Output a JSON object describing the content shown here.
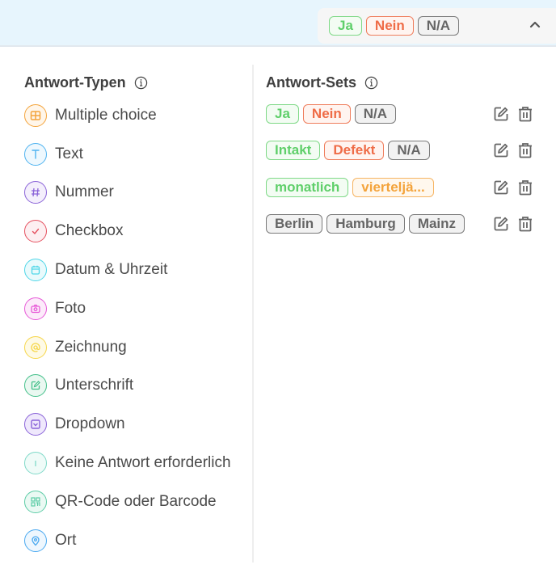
{
  "header": {
    "selected_set": [
      {
        "label": "Ja",
        "color": "green"
      },
      {
        "label": "Nein",
        "color": "red"
      },
      {
        "label": "N/A",
        "color": "gray"
      }
    ],
    "toggle_icon": "chevron-up-icon"
  },
  "answer_types": {
    "title": "Antwort-Typen",
    "info_icon": "info-icon",
    "items": [
      {
        "label": "Multiple choice",
        "icon": "grid-icon",
        "color": "#f4a43c",
        "bg": "#fff6ea"
      },
      {
        "label": "Text",
        "icon": "text-icon",
        "color": "#4fb3f0",
        "bg": "#eef8fe"
      },
      {
        "label": "Nummer",
        "icon": "hash-icon",
        "color": "#8a63d8",
        "bg": "#f4effc"
      },
      {
        "label": "Checkbox",
        "icon": "check-icon",
        "color": "#e5505f",
        "bg": "#fdeff1"
      },
      {
        "label": "Datum & Uhrzeit",
        "icon": "calendar-icon",
        "color": "#4fd6e8",
        "bg": "#e9fafc"
      },
      {
        "label": "Foto",
        "icon": "camera-icon",
        "color": "#e75ad8",
        "bg": "#fcebfa"
      },
      {
        "label": "Zeichnung",
        "icon": "at-icon",
        "color": "#f6d64a",
        "bg": "#fefae6"
      },
      {
        "label": "Unterschrift",
        "icon": "signature-icon",
        "color": "#44c08a",
        "bg": "#eaf8f1"
      },
      {
        "label": "Dropdown",
        "icon": "dropdown-icon",
        "color": "#8a63d8",
        "bg": "#efe8fc"
      },
      {
        "label": "Keine Antwort erforderlich",
        "icon": "info-icon",
        "color": "#7fd9c8",
        "bg": "#effbf8"
      },
      {
        "label": "QR-Code oder Barcode",
        "icon": "qr-code-icon",
        "color": "#5ccca6",
        "bg": "#eaf9f3"
      },
      {
        "label": "Ort",
        "icon": "location-pin-icon",
        "color": "#4aa9f0",
        "bg": "#eef7fe"
      }
    ]
  },
  "answer_sets": {
    "title": "Antwort-Sets",
    "info_icon": "info-icon",
    "edit_icon": "edit-icon",
    "delete_icon": "trash-icon",
    "sets": [
      {
        "tags": [
          {
            "label": "Ja",
            "color": "green"
          },
          {
            "label": "Nein",
            "color": "red"
          },
          {
            "label": "N/A",
            "color": "gray"
          }
        ]
      },
      {
        "tags": [
          {
            "label": "Intakt",
            "color": "green"
          },
          {
            "label": "Defekt",
            "color": "red"
          },
          {
            "label": "N/A",
            "color": "gray"
          }
        ]
      },
      {
        "tags": [
          {
            "label": "monatlich",
            "color": "green"
          },
          {
            "label": "vierteljä...",
            "color": "orange"
          }
        ]
      },
      {
        "tags": [
          {
            "label": "Berlin",
            "color": "gray"
          },
          {
            "label": "Hamburg",
            "color": "gray"
          },
          {
            "label": "Mainz",
            "color": "gray"
          }
        ]
      }
    ]
  }
}
